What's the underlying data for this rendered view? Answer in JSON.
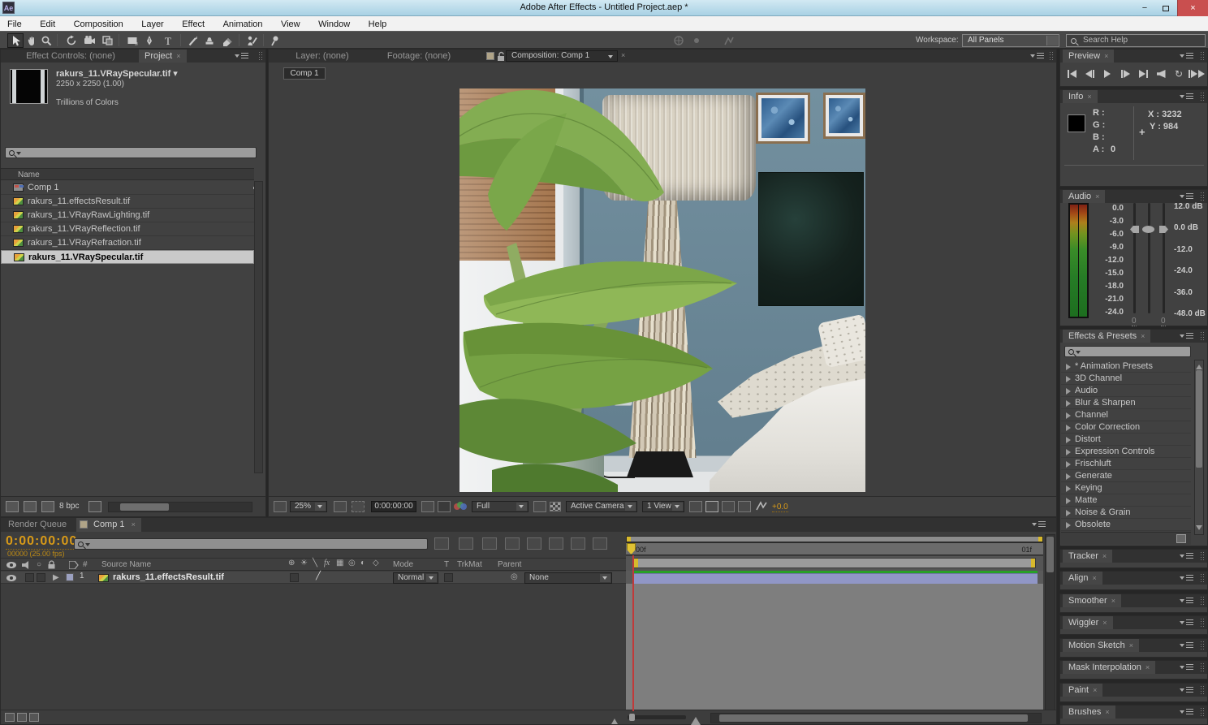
{
  "colors": {
    "titlebar_blue": "#a8d1e4",
    "accent_orange": "#d89a18",
    "selection_gray": "#c9c9c9",
    "layer_bar_lavender": "#9096c6",
    "rendered_frames_green": "#27a027",
    "cti_red": "#c03a3a",
    "close_button_red": "#c94f4f"
  },
  "title_bar": {
    "title": "Adobe After Effects - Untitled Project.aep *"
  },
  "menu_bar": {
    "items": [
      "File",
      "Edit",
      "Composition",
      "Layer",
      "Effect",
      "Animation",
      "View",
      "Window",
      "Help"
    ]
  },
  "toolbar": {
    "workspace_label": "Workspace:",
    "workspace_value": "All Panels",
    "help_search_placeholder": "Search Help",
    "tools": [
      "selection",
      "hand",
      "zoom",
      "rotation",
      "unified-camera",
      "pan-behind",
      "rectangle",
      "pen",
      "type",
      "brush",
      "clone-stamp",
      "eraser",
      "roto-brush",
      "puppet-pin"
    ]
  },
  "project_panel": {
    "tabs": {
      "effect_controls": "Effect Controls: (none)",
      "project": "Project"
    },
    "preview": {
      "name": "rakurs_11.VRaySpecular.tif",
      "dimensions": "2250 x 2250 (1.00)",
      "color_depth": "Trillions of Colors"
    },
    "list_header": "Name",
    "items": [
      {
        "name": "Comp 1",
        "type": "composition",
        "selected": false
      },
      {
        "name": "rakurs_11.effectsResult.tif",
        "type": "footage",
        "selected": false
      },
      {
        "name": "rakurs_11.VRayRawLighting.tif",
        "type": "footage",
        "selected": false
      },
      {
        "name": "rakurs_11.VRayReflection.tif",
        "type": "footage",
        "selected": false
      },
      {
        "name": "rakurs_11.VRayRefraction.tif",
        "type": "footage",
        "selected": false
      },
      {
        "name": "rakurs_11.VRaySpecular.tif",
        "type": "footage",
        "selected": true
      }
    ],
    "bit_depth": "8 bpc"
  },
  "viewer": {
    "tabs": {
      "layer": "Layer: (none)",
      "footage": "Footage: (none)",
      "composition": "Composition: Comp 1"
    },
    "comp_button": "Comp 1",
    "controls": {
      "zoom": "25%",
      "timecode": "0:00:00:00",
      "resolution": "Full",
      "camera": "Active Camera",
      "view_layout": "1 View",
      "exposure": "+0.0"
    }
  },
  "preview_panel": {
    "title": "Preview",
    "buttons": [
      "first-frame",
      "previous-frame",
      "play",
      "next-frame",
      "last-frame",
      "audio",
      "loop",
      "ram-preview"
    ]
  },
  "info_panel": {
    "title": "Info",
    "labels": {
      "r": "R :",
      "g": "G :",
      "b": "B :",
      "a": "A :"
    },
    "values": {
      "a": "0"
    },
    "coordinates": {
      "x": "X : 3232",
      "y": "Y : 984"
    }
  },
  "audio_panel": {
    "title": "Audio",
    "left_scale": [
      "0.0",
      "-3.0",
      "-6.0",
      "-9.0",
      "-12.0",
      "-15.0",
      "-18.0",
      "-21.0",
      "-24.0"
    ],
    "right_scale": [
      "12.0 dB",
      "0.0 dB",
      "-12.0",
      "-24.0",
      "-36.0",
      "-48.0 dB"
    ],
    "slider_values": [
      "0",
      "0"
    ]
  },
  "effects_panel": {
    "title": "Effects & Presets",
    "categories": [
      "* Animation Presets",
      "3D Channel",
      "Audio",
      "Blur & Sharpen",
      "Channel",
      "Color Correction",
      "Distort",
      "Expression Controls",
      "Frischluft",
      "Generate",
      "Keying",
      "Matte",
      "Noise & Grain",
      "Obsolete"
    ]
  },
  "collapsed_panels": [
    "Tracker",
    "Align",
    "Smoother",
    "Wiggler",
    "Motion Sketch",
    "Mask Interpolation",
    "Paint",
    "Brushes"
  ],
  "timeline": {
    "tabs": {
      "render_queue": "Render Queue",
      "comp": "Comp 1"
    },
    "timecode": "0:00:00:00",
    "frame_rate_info": "00000 (25.00 fps)",
    "columns": {
      "source_name": "Source Name",
      "mode": "Mode",
      "t": "T",
      "trkmat": "TrkMat",
      "parent": "Parent"
    },
    "layer": {
      "index": "1",
      "source_name": "rakurs_11.effectsResult.tif",
      "mode": "Normal",
      "parent": "None"
    },
    "ruler": {
      "start_label": "00f",
      "end_label": "01f"
    }
  }
}
